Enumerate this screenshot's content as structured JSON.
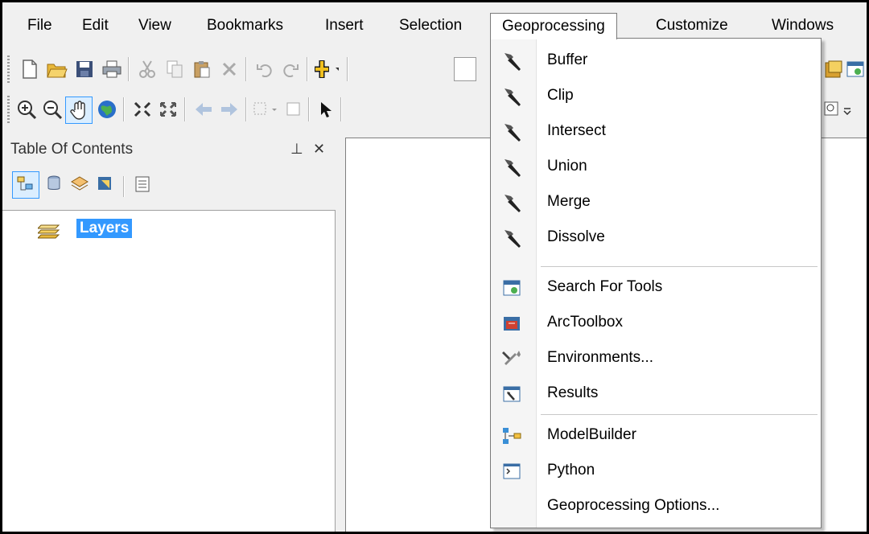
{
  "menubar": {
    "items": [
      "File",
      "Edit",
      "View",
      "Bookmarks",
      "Insert",
      "Selection",
      "Geoprocessing",
      "Customize",
      "Windows"
    ],
    "open_item": "Geoprocessing"
  },
  "toc": {
    "title": "Table Of Contents",
    "pin_glyph": "⊥",
    "close_glyph": "✕",
    "root_layer": "Layers"
  },
  "geoprocessing_menu": {
    "tools": [
      "Buffer",
      "Clip",
      "Intersect",
      "Union",
      "Merge",
      "Dissolve"
    ],
    "tool_icon": "hammer-icon",
    "search_for_tools": "Search For Tools",
    "arctoolbox": "ArcToolbox",
    "environments": "Environments...",
    "results": "Results",
    "modelbuilder": "ModelBuilder",
    "python": "Python",
    "options": "Geoprocessing Options..."
  },
  "colors": {
    "selection": "#3399ff",
    "chrome": "#f0f0f0"
  }
}
